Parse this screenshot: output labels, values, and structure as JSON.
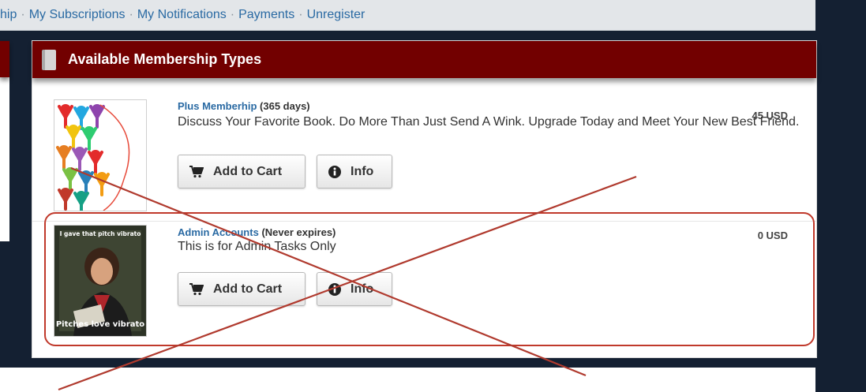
{
  "nav": {
    "items": [
      {
        "label": "hip"
      },
      {
        "label": "My Subscriptions"
      },
      {
        "label": "My Notifications"
      },
      {
        "label": "Payments"
      },
      {
        "label": "Unregister"
      }
    ],
    "separator": "·"
  },
  "panel": {
    "title": "Available Membership Types"
  },
  "memberships": [
    {
      "name": "Plus Memberhip",
      "duration": "(365 days)",
      "price": "45 USD",
      "description": "Discuss Your Favorite Book. Do More Than Just Send A Wink. Upgrade Today and Meet Your New Best Friend.",
      "cart_label": "Add to Cart",
      "info_label": "Info"
    },
    {
      "name": "Admin Accounts",
      "duration": "(Never expires)",
      "price": "0 USD",
      "description": "This is for Admin Tasks Only",
      "cart_label": "Add to Cart",
      "info_label": "Info",
      "thumb_caption_top": "I gave that pitch vibrato",
      "thumb_caption_bottom": "Pitches love vibrato"
    }
  ],
  "colors": {
    "header_bg": "#720000",
    "page_bg": "#142032",
    "link": "#2a6aa3",
    "annotation": "#c0392b"
  },
  "icons": [
    "book-icon",
    "cart-icon",
    "info-icon"
  ]
}
